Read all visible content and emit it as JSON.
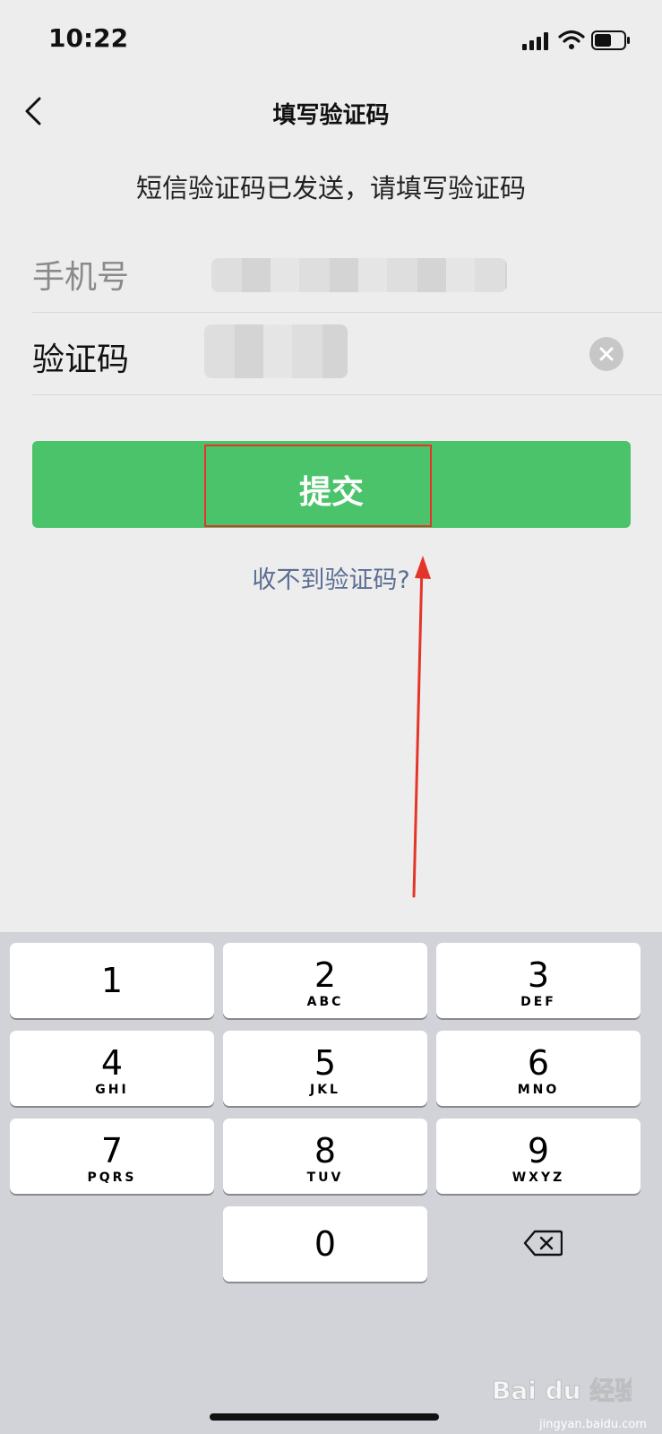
{
  "status_bar": {
    "time": "10:22"
  },
  "nav": {
    "title": "填写验证码"
  },
  "notice": "短信验证码已发送，请填写验证码",
  "form": {
    "phone_label": "手机号",
    "code_label": "验证码"
  },
  "submit_label": "提交",
  "help_link": "收不到验证码?",
  "keypad": {
    "keys": [
      {
        "digit": "1",
        "letters": ""
      },
      {
        "digit": "2",
        "letters": "ABC"
      },
      {
        "digit": "3",
        "letters": "DEF"
      },
      {
        "digit": "4",
        "letters": "GHI"
      },
      {
        "digit": "5",
        "letters": "JKL"
      },
      {
        "digit": "6",
        "letters": "MNO"
      },
      {
        "digit": "7",
        "letters": "PQRS"
      },
      {
        "digit": "8",
        "letters": "TUV"
      },
      {
        "digit": "9",
        "letters": "WXYZ"
      },
      {
        "digit": "0",
        "letters": ""
      }
    ]
  },
  "watermark": {
    "brand": "Bai du 经验",
    "url": "jingyan.baidu.com"
  },
  "colors": {
    "primary_green": "#4AC36A",
    "link": "#5C6E94",
    "highlight_red": "#E5352A",
    "background": "#EDEDED",
    "keyboard_bg": "#D1D3D9"
  },
  "icons": [
    "signal-icon",
    "wifi-icon",
    "battery-icon",
    "back-arrow-icon",
    "clear-icon",
    "backspace-icon",
    "annotation-arrow"
  ]
}
